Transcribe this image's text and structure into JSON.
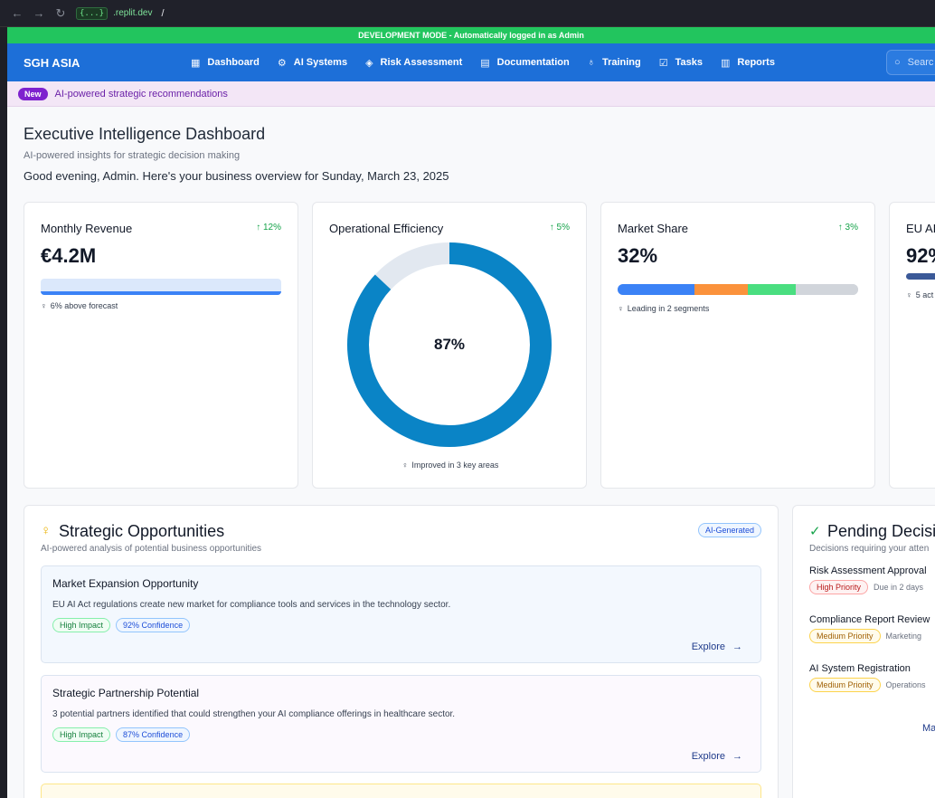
{
  "browser": {
    "url_badge": "{...}",
    "url_host": ".replit.dev",
    "url_path": "/"
  },
  "dev_banner": "DEVELOPMENT MODE - Automatically logged in as Admin",
  "brand": "SGH ASIA",
  "nav": [
    {
      "label": "Dashboard",
      "icon": "dashboard-icon"
    },
    {
      "label": "AI Systems",
      "icon": "cpu-icon"
    },
    {
      "label": "Risk Assessment",
      "icon": "shield-icon"
    },
    {
      "label": "Documentation",
      "icon": "document-icon"
    },
    {
      "label": "Training",
      "icon": "lightbulb-icon"
    },
    {
      "label": "Tasks",
      "icon": "checkbox-icon"
    },
    {
      "label": "Reports",
      "icon": "bar-chart-icon"
    }
  ],
  "search": {
    "placeholder": "Searc"
  },
  "promo": {
    "badge": "New",
    "text": "AI-powered strategic recommendations"
  },
  "header": {
    "title": "Executive Intelligence Dashboard",
    "subtitle": "AI-powered insights for strategic decision making",
    "greeting": "Good evening, Admin. Here's your business overview for Sunday, March 23, 2025"
  },
  "kpis": {
    "revenue": {
      "title": "Monthly Revenue",
      "change": "↑ 12%",
      "value": "€4.2M",
      "footer": "6% above forecast",
      "bar_fill": 1.0
    },
    "efficiency": {
      "title": "Operational Efficiency",
      "change": "↑ 5%",
      "value": "87%",
      "percent": 87,
      "footer": "Improved in 3 key areas"
    },
    "market": {
      "title": "Market Share",
      "change": "↑ 3%",
      "value": "32%",
      "footer": "Leading in 2 segments",
      "segments": [
        32,
        22,
        20,
        26
      ]
    },
    "eu_ai": {
      "title": "EU AI",
      "value": "92%",
      "footer": "5 act"
    }
  },
  "colors": {
    "efficiency_ring": "#0a84c6",
    "ring_track": "#e2e8f0",
    "segments": [
      "#3b82f6",
      "#fb923c",
      "#4ade80",
      "#d1d5db"
    ]
  },
  "opportunities": {
    "title": "Strategic Opportunities",
    "subtitle": "AI-powered analysis of potential business opportunities",
    "badge": "AI-Generated",
    "items": [
      {
        "title": "Market Expansion Opportunity",
        "desc": "EU AI Act regulations create new market for compliance tools and services in the technology sector.",
        "impact": "High Impact",
        "confidence": "92% Confidence",
        "explore": "Explore"
      },
      {
        "title": "Strategic Partnership Potential",
        "desc": "3 potential partners identified that could strengthen your AI compliance offerings in healthcare sector.",
        "impact": "High Impact",
        "confidence": "87% Confidence",
        "explore": "Explore"
      }
    ]
  },
  "decisions": {
    "title": "Pending Decisio",
    "subtitle": "Decisions requiring your atten",
    "items": [
      {
        "title": "Risk Assessment Approval",
        "priority": "High Priority",
        "meta": "Due in 2 days"
      },
      {
        "title": "Compliance Report Review",
        "priority": "Medium Priority",
        "meta": "Marketing"
      },
      {
        "title": "AI System Registration",
        "priority": "Medium Priority",
        "meta": "Operations"
      }
    ],
    "more": "Ma"
  }
}
